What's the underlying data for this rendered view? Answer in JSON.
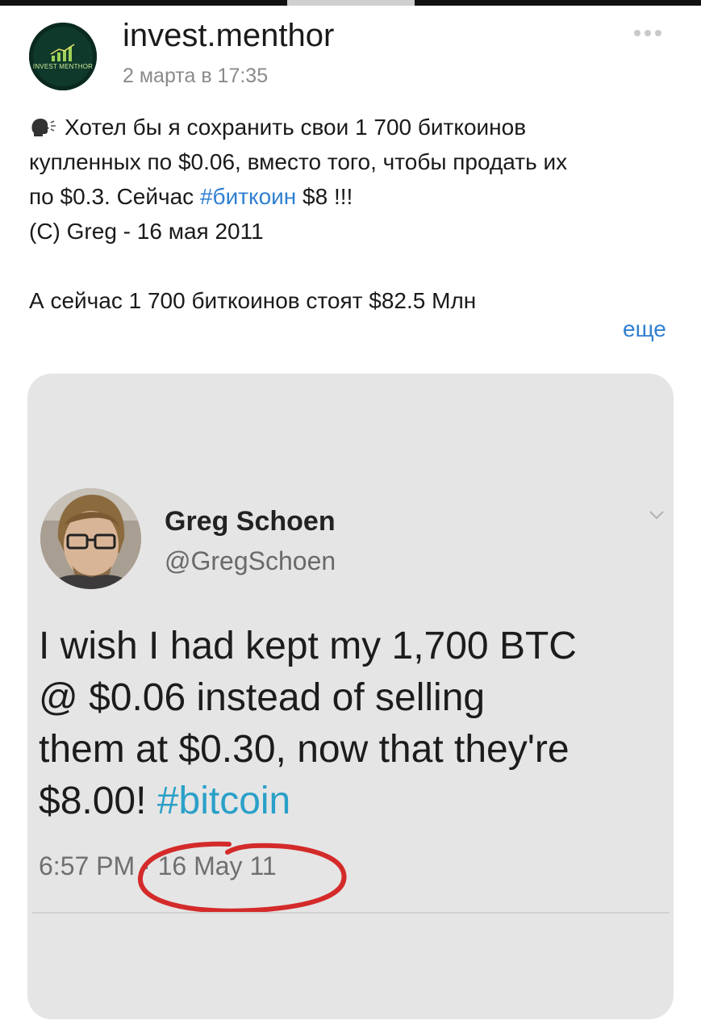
{
  "post": {
    "author": "invest.menthor",
    "time": "2 марта в 17:35",
    "avatar_logo_text": "INVEST MENTHOR",
    "text_lines": [
      "Хотел бы я сохранить свои 1 700 биткоинов",
      "купленных по $0.06, вместо того, чтобы продать их"
    ],
    "line3_prefix": "по $0.3. Сейчас ",
    "line3_hashtag": "#биткоин",
    "line3_suffix": " $8 !!!",
    "line4": "(С) Greg - 16 мая 2011",
    "line5": "А сейчас 1 700 биткоинов стоят $82.5 Млн",
    "more_label": "еще"
  },
  "tweet": {
    "name": "Greg Schoen",
    "handle": "@GregSchoen",
    "text_lines": [
      "I wish I had kept my 1,700 BTC",
      "@ $0.06 instead of selling",
      "them at $0.30, now that they're"
    ],
    "last_line_prefix": "$8.00! ",
    "hashtag": "#bitcoin",
    "date": "6:57 PM · 16 May 11"
  },
  "colors": {
    "link": "#2f7fd1",
    "tweet_hashtag": "#2aa0c8",
    "circle": "#d42a2a",
    "card_bg": "#e5e5e5"
  },
  "icons": [
    "speaking-head-icon",
    "more-options-icon",
    "chevron-down-icon"
  ]
}
